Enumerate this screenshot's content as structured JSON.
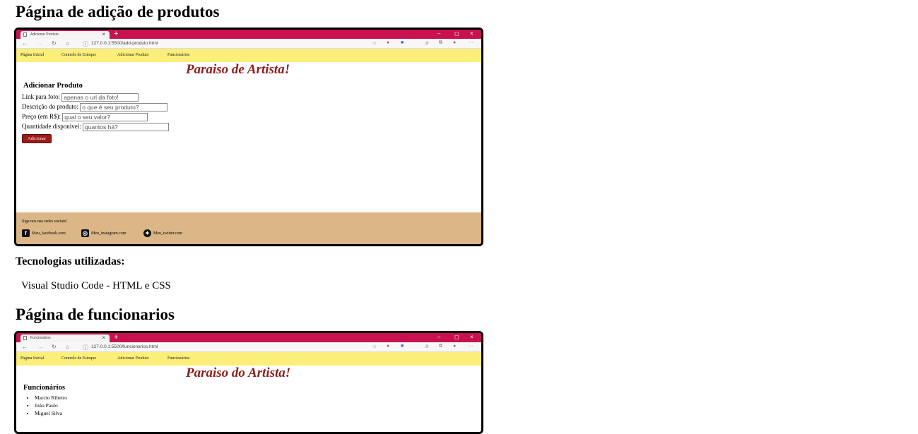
{
  "sections": {
    "add_product_title": "Página de adição de produtos",
    "technologies_heading": "Tecnologias utilizadas:",
    "technologies_text": "Visual Studio Code - HTML e CSS",
    "employees_title": "Página de funcionarios"
  },
  "browser_common": {
    "new_tab": "+",
    "tab_close": "×",
    "minimize": "–",
    "maximize": "◻",
    "close": "×",
    "back": "←",
    "forward": "→",
    "reload": "↻",
    "home": "⌂",
    "info": "ⓘ",
    "menu": "···"
  },
  "screenshot1": {
    "tab_title": "Adicionar Produto",
    "url": "127.0.0.1:5500/add-produto.html",
    "nav": [
      "Página Inicial",
      "Controle de Estoque",
      "Adicionar Produto",
      "Funcionários"
    ],
    "brand": "Paraiso de Artista!",
    "form": {
      "title": "Adicionar Produto",
      "rows": [
        {
          "label": "Link para foto:",
          "placeholder": "apenas o url da foto!"
        },
        {
          "label": "Descrição do produto:",
          "placeholder": "o que é seu produto?"
        },
        {
          "label": "Preço (em R$):",
          "placeholder": "qual o seu valor?"
        },
        {
          "label": "Quantidade disponível:",
          "placeholder": "quantos há?"
        }
      ],
      "button": "Adicionar"
    },
    "footer": {
      "label": "Siga nos nas redes sociais!",
      "links": [
        "Meu_facebook.com",
        "Meu_instagram.com",
        "Meu_twitter.com"
      ]
    }
  },
  "screenshot2": {
    "tab_title": "Funcionários",
    "url": "127.0.0.1:5500/funcionarios.html",
    "nav": [
      "Página Inicial",
      "Controle de Estoque",
      "Adicionar Produto",
      "Funcionários"
    ],
    "brand": "Paraiso do Artista!",
    "employees_title": "Funcionários",
    "employees": [
      "Marcio Ribeiro",
      "João Paulo",
      "Miguel Silva"
    ]
  },
  "colors": {
    "tabbar": "#c8124f",
    "nav_bg": "#fbee7a",
    "brand": "#8f1c1c",
    "footer_bg": "#dbb686",
    "button": "#9c1b1b"
  }
}
